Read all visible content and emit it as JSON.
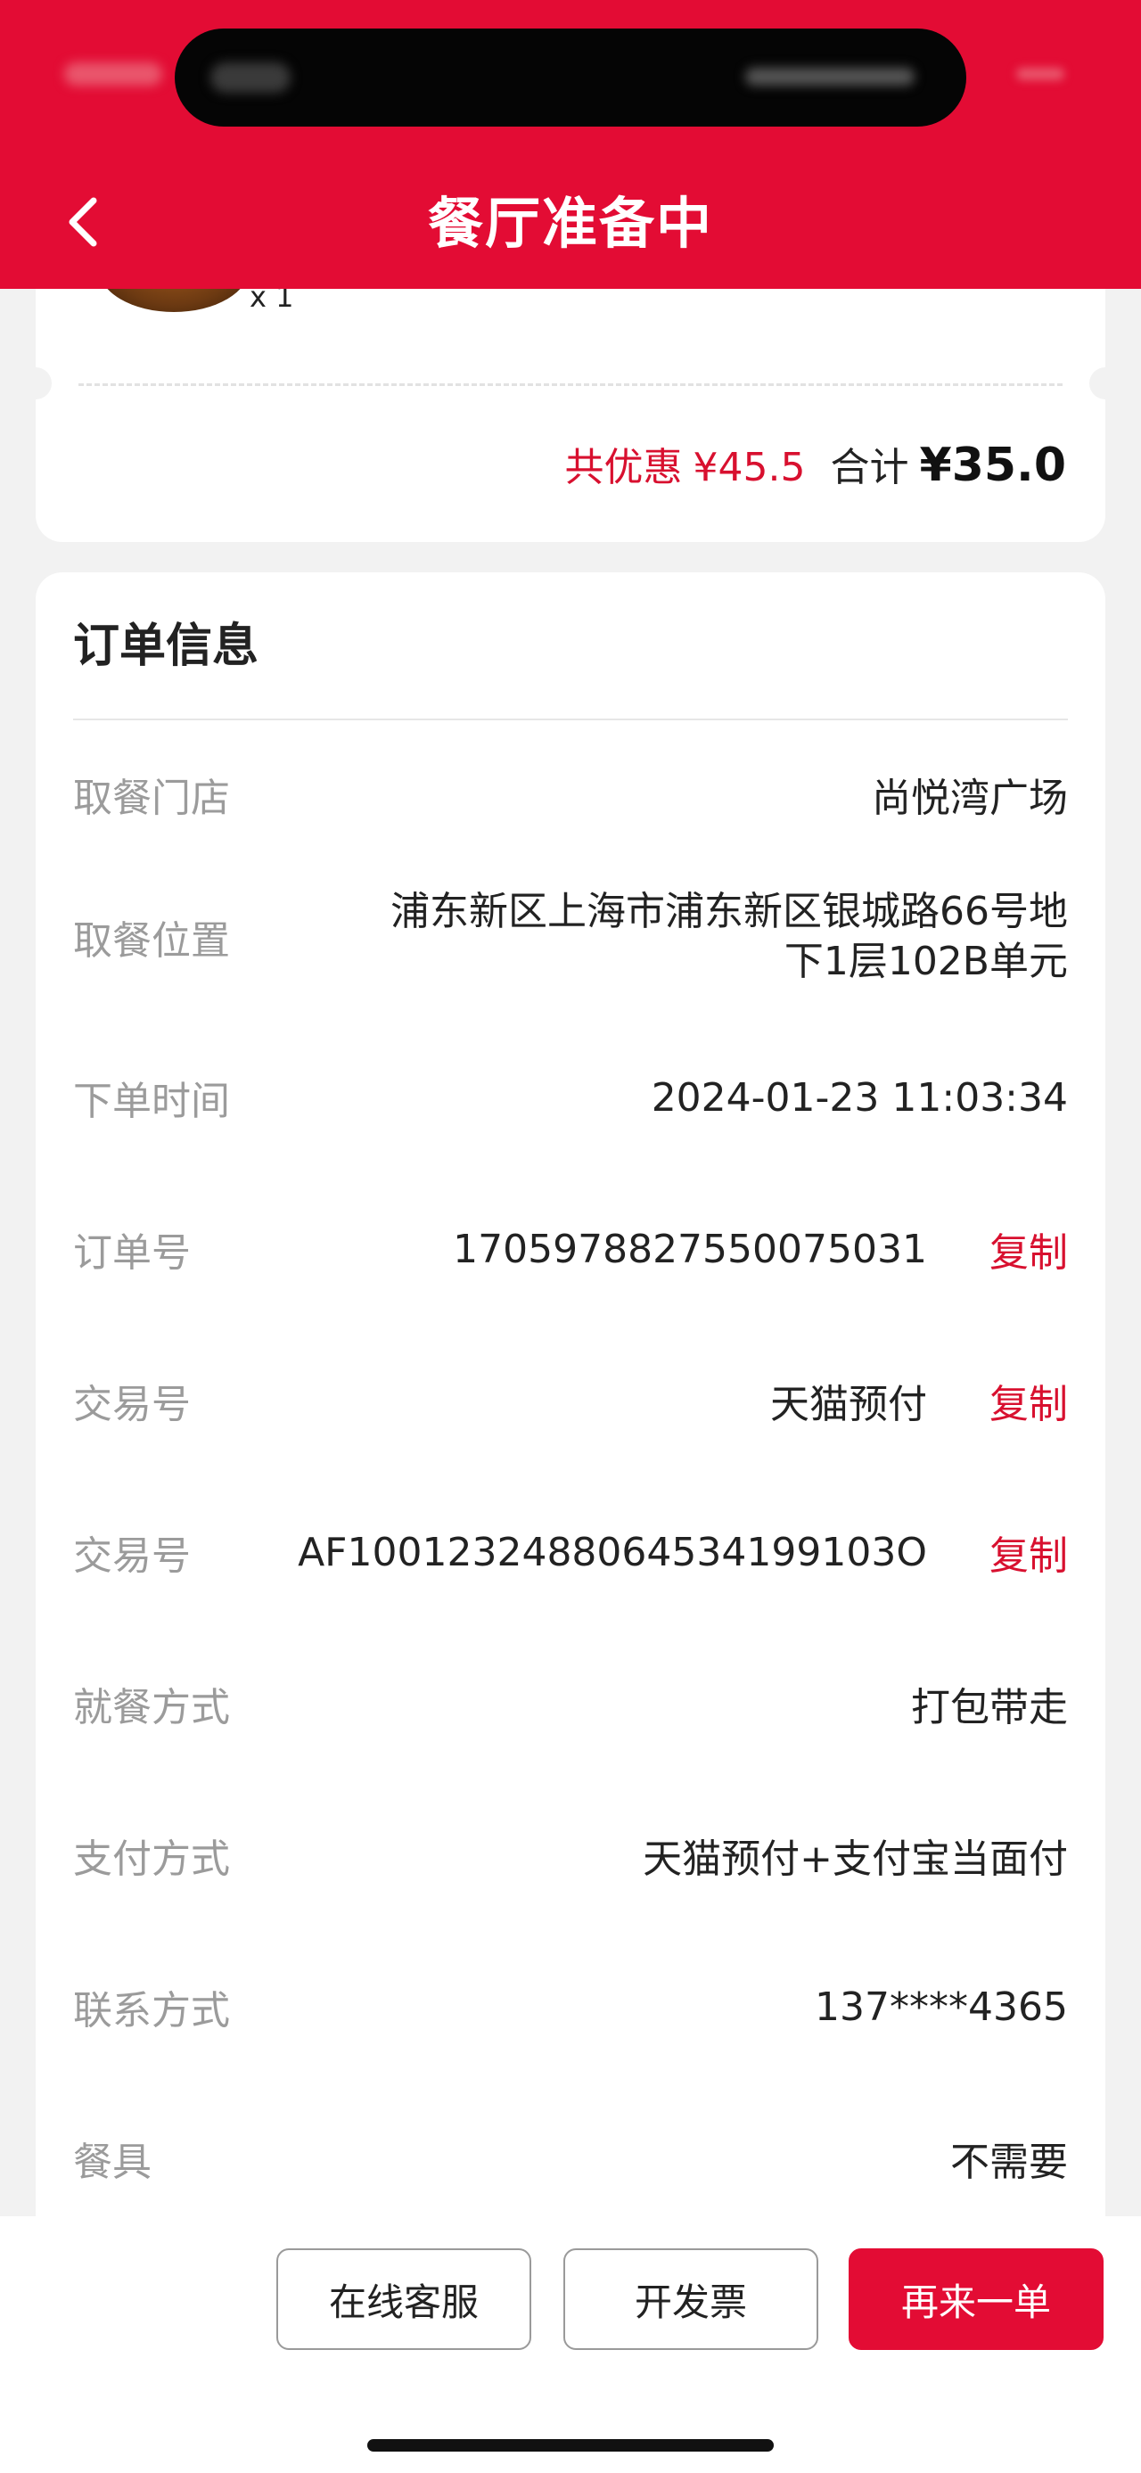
{
  "colors": {
    "brand": "#e30c34",
    "accent": "#d8102f"
  },
  "header": {
    "title": "餐厅准备中",
    "back_icon": "chevron-left-icon"
  },
  "summary": {
    "quantity": "x 1",
    "discount_label": "共优惠",
    "discount_value": "¥45.5",
    "total_label": "合计",
    "total_value": "¥35.0"
  },
  "order_info": {
    "title": "订单信息",
    "rows": [
      {
        "label": "取餐门店",
        "value": "尚悦湾广场",
        "copy": ""
      },
      {
        "label": "取餐位置",
        "value": "浦东新区上海市浦东新区银城路66号地下1层102B单元",
        "copy": ""
      },
      {
        "label": "下单时间",
        "value": "2024-01-23 11:03:34",
        "copy": ""
      },
      {
        "label": "订单号",
        "value": "1705978827550075031",
        "copy": "复制"
      },
      {
        "label": "交易号",
        "value": "天猫预付",
        "copy": "复制"
      },
      {
        "label": "交易号",
        "value": "AF1001232488064534199103O",
        "copy": "复制"
      },
      {
        "label": "就餐方式",
        "value": "打包带走",
        "copy": ""
      },
      {
        "label": "支付方式",
        "value": "天猫预付+支付宝当面付",
        "copy": ""
      },
      {
        "label": "联系方式",
        "value": "137****4365",
        "copy": ""
      },
      {
        "label": "餐具",
        "value": "不需要",
        "copy": ""
      }
    ]
  },
  "bottom_bar": {
    "customer_service": "在线客服",
    "invoice": "开发票",
    "reorder": "再来一单"
  }
}
